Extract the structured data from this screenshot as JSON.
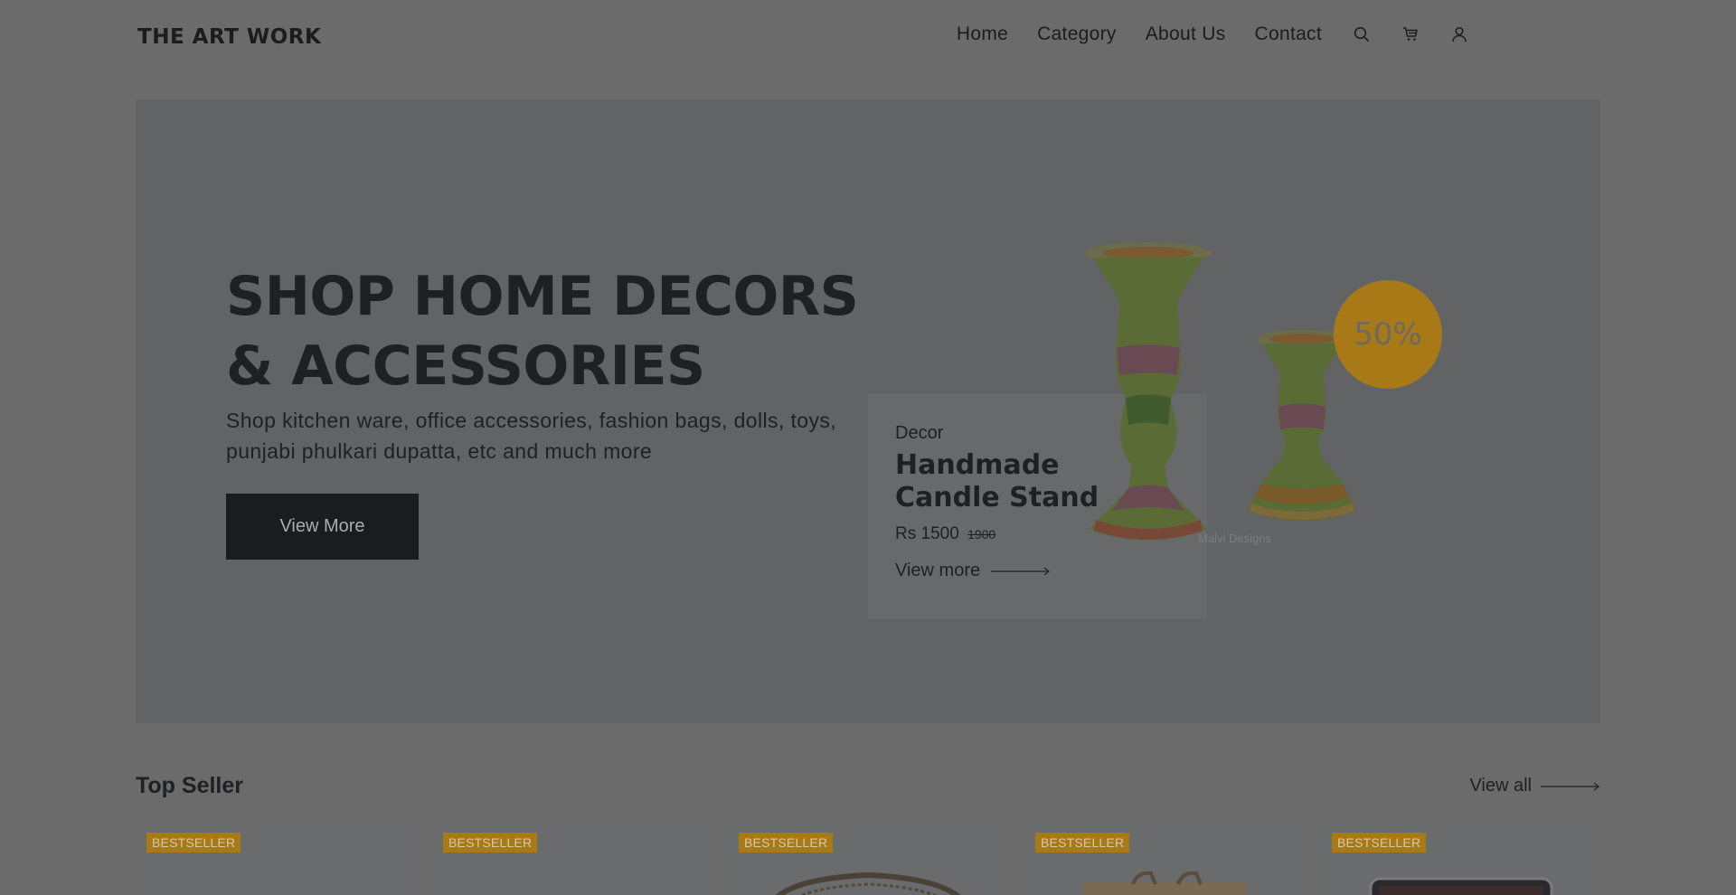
{
  "brand": {
    "logo_text": "THE ART WORK"
  },
  "nav": {
    "items": [
      {
        "label": "Home"
      },
      {
        "label": "Category"
      },
      {
        "label": "About Us"
      },
      {
        "label": "Contact"
      }
    ],
    "icons": [
      "search-icon",
      "cart-icon",
      "user-icon"
    ]
  },
  "hero": {
    "title_line1": "SHOP HOME DECORS",
    "title_line2": "& ACCESSORIES",
    "subtitle": "Shop kitchen ware, office accessories, fashion bags, dolls, toys, punjabi phulkari dupatta, etc and much more",
    "button_label": "View More",
    "badge_text": "50%",
    "watermark": "Malvi Designs",
    "product": {
      "category": "Decor",
      "name": "Handmade Candle Stand",
      "price": "Rs 1500",
      "old_price": "1900",
      "link_label": "View more"
    }
  },
  "top_seller": {
    "title": "Top Seller",
    "view_all_label": "View all",
    "cards": [
      {
        "tag": "BESTSELLER",
        "thumb": "none"
      },
      {
        "tag": "BESTSELLER",
        "thumb": "none"
      },
      {
        "tag": "BESTSELLER",
        "thumb": "basket"
      },
      {
        "tag": "BESTSELLER",
        "thumb": "bag"
      },
      {
        "tag": "BESTSELLER",
        "thumb": "pouch"
      }
    ]
  },
  "colors": {
    "page_bg": "#6b6b6b",
    "hero_bg": "#626365",
    "accent": "#a87a17",
    "button_bg": "#1b1c1f"
  }
}
